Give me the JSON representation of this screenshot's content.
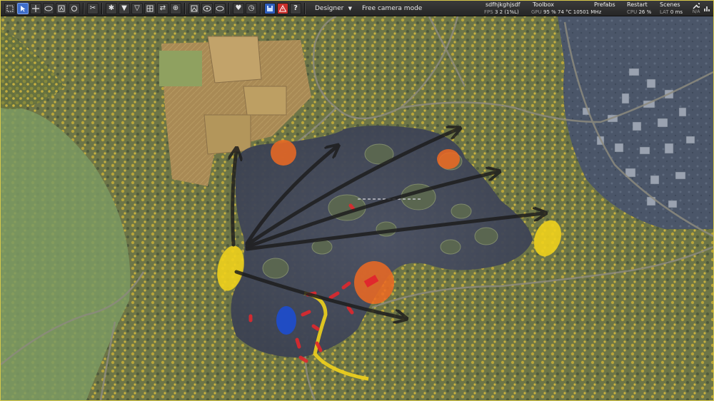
{
  "toolbar": {
    "icons": [
      "select-icon",
      "cursor-icon",
      "move-icon",
      "rotate-icon",
      "terrain-icon",
      "circle-icon",
      "cut-icon",
      "node-icon",
      "marker-down-icon",
      "marker-up-icon",
      "grid-icon",
      "shuffle-icon",
      "target-icon",
      "image-icon",
      "tag-icon",
      "eye-icon",
      "heart-icon",
      "timer-icon",
      "save-icon",
      "warning-icon",
      "help-icon"
    ],
    "mode_label": "Designer",
    "camera_mode": "Free camera mode"
  },
  "status": {
    "project_name": "sdfhjkghjsdf",
    "toolbox_label": "Toolbox",
    "prefabs_label": "Prefabs",
    "restart_label": "Restart",
    "scenes_label": "Scenes",
    "fps_label": "FPS",
    "fps_value": "3",
    "fps_extra": "2 (1%L)",
    "gpu_label": "GPU",
    "gpu_value": "95 % 74 °C 10501 MHz",
    "cpu_label": "CPU",
    "cpu_value": "26 %",
    "lat_label": "LAT",
    "lat_value": "0 ms",
    "na_label": "N/A"
  },
  "colors": {
    "accent": "#3f6ec9",
    "warning": "#c9302c",
    "marker_yellow": "#f0d21c",
    "marker_orange": "#ee6a22",
    "marker_blue": "#1d4ccf",
    "marker_red": "#e0282d",
    "arrow": "#1e1e1e"
  }
}
